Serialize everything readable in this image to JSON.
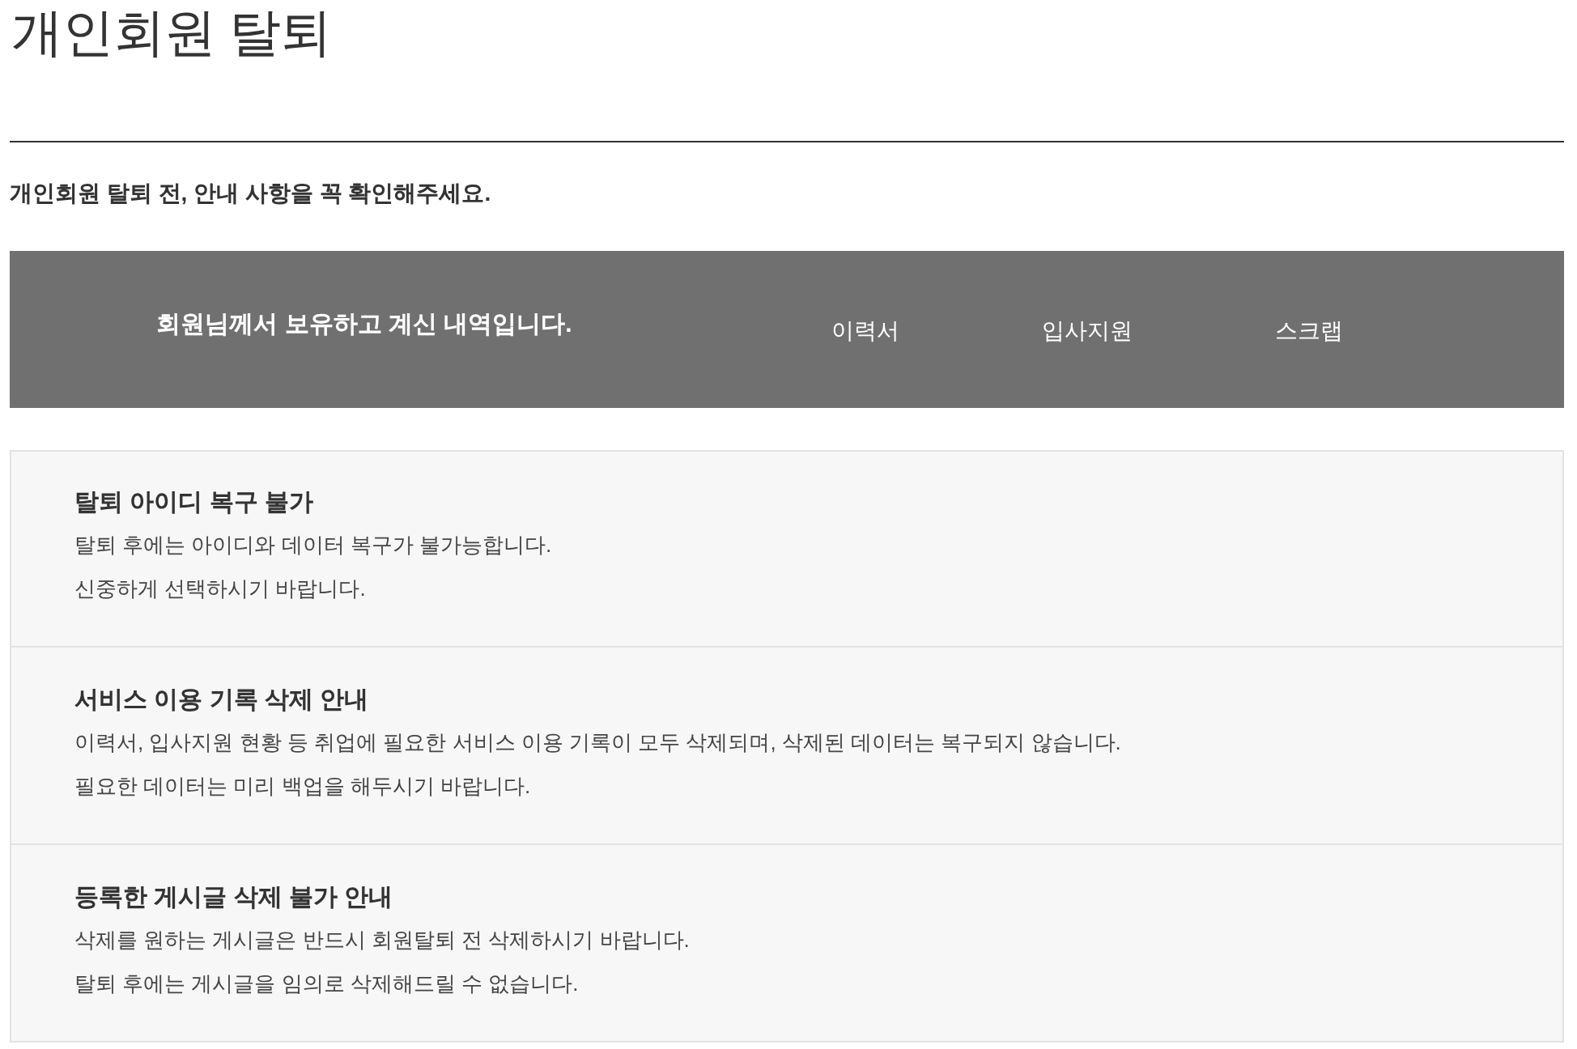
{
  "page": {
    "title": "개인회원 탈퇴",
    "intro": "개인회원 탈퇴 전, 안내 사항을 꼭 확인해주세요."
  },
  "holdings": {
    "message": "회원님께서 보유하고 계신 내역입니다.",
    "items": [
      "이력서",
      "입사지원",
      "스크랩"
    ]
  },
  "notices": [
    {
      "heading": "탈퇴 아이디 복구 불가",
      "lines": [
        "탈퇴 후에는 아이디와 데이터 복구가 불가능합니다.",
        "신중하게 선택하시기 바랍니다."
      ]
    },
    {
      "heading": "서비스 이용 기록 삭제 안내",
      "lines": [
        "이력서, 입사지원 현황 등 취업에 필요한 서비스 이용 기록이 모두 삭제되며, 삭제된 데이터는 복구되지 않습니다.",
        "필요한 데이터는 미리 백업을 해두시기 바랍니다."
      ]
    },
    {
      "heading": "등록한 게시글 삭제 불가 안내",
      "lines": [
        "삭제를 원하는 게시글은 반드시 회원탈퇴 전 삭제하시기 바랍니다.",
        "탈퇴 후에는 게시글을 임의로 삭제해드릴 수 없습니다."
      ]
    }
  ]
}
